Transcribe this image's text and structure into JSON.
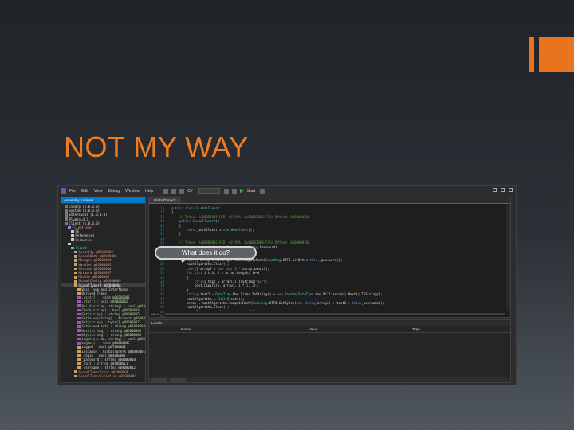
{
  "slide": {
    "title": "NOT MY WAY",
    "accent_color": "#e8741e",
    "title_color": "#f07c22"
  },
  "ide": {
    "menu": [
      "File",
      "Edit",
      "View",
      "Debug",
      "Window",
      "Help"
    ],
    "toolbar": {
      "config_select": "C#",
      "start_label": "Start"
    },
    "explorer": {
      "title": "Assembly Explorer",
      "items": [
        {
          "label": "CSharp (1.0.0.0)",
          "color": "#dcdcdc"
        },
        {
          "label": "System (4.0.0.0)",
          "color": "#dcdcdc"
        },
        {
          "label": "Extensions (1.0.0.0)",
          "color": "#dcdcdc"
        },
        {
          "label": "Plugin.dll",
          "color": "#dcdcdc"
        },
        {
          "label": "Client (1.0.0.0)",
          "color": "#dcdcdc"
        },
        {
          "label": "Client.exe",
          "color": "#d69d85"
        },
        {
          "label": "PE",
          "color": "#dcdcdc"
        },
        {
          "label": "References",
          "color": "#dcdcdc"
        },
        {
          "label": "Resources",
          "color": "#dcdcdc"
        },
        {
          "label": "{ }",
          "color": "#dcdcdc"
        },
        {
          "label": "Client",
          "color": "#4ec9b0"
        },
        {
          "label": "Security @02000002",
          "color": "#d69d85"
        },
        {
          "label": "GlobalData @02000003",
          "color": "#d69d85"
        },
        {
          "label": "Manager @02000004",
          "color": "#d69d85"
        },
        {
          "label": "Handler @02000005",
          "color": "#d69d85"
        },
        {
          "label": "Session @02000006",
          "color": "#d69d85"
        },
        {
          "label": "Network @02000007",
          "color": "#d69d85"
        },
        {
          "label": "Module @02000008",
          "color": "#d69d85"
        },
        {
          "label": "GlobalConfig @02000009",
          "color": "#d69d85"
        },
        {
          "label": "GlobalTunerX @0200000A",
          "color": "#ffffff"
        },
        {
          "label": "Base Type and Interfaces",
          "color": "#dcdcdc"
        },
        {
          "label": "Derived Types",
          "color": "#dcdcdc"
        },
        {
          "label": ".cctor() : void @06000001",
          "color": "#b8d7a3"
        },
        {
          "label": ".ctor() : void @06000002",
          "color": "#b8d7a3"
        },
        {
          "label": "Build(string, string) : bool @06000003",
          "color": "#b8d7a3"
        },
        {
          "label": "Check(string) : bool @06000004",
          "color": "#b8d7a3"
        },
        {
          "label": "Get(string) : string @06000005",
          "color": "#b8d7a3"
        },
        {
          "label": "GetValue(string) : Account @06000006",
          "color": "#b8d7a3"
        },
        {
          "label": "Set(string) : byte[] @06000007",
          "color": "#b8d7a3"
        },
        {
          "label": "SetSecond(int) : string @06000008",
          "color": "#b8d7a3"
        },
        {
          "label": "Hash(string) : string @06000009",
          "color": "#b8d7a3"
        },
        {
          "label": "Keys(string) : string @0600000A",
          "color": "#b8d7a3"
        },
        {
          "label": "Login(string, string) : bool @0600000B",
          "color": "#b8d7a3"
        },
        {
          "label": "Logout() : void @0600000C",
          "color": "#b8d7a3"
        },
        {
          "label": "Logged : bool @17000001",
          "color": "#dcdcdc"
        },
        {
          "label": "Instance : GlobalTunerX @0400000E",
          "color": "#dcdcdc"
        },
        {
          "label": "_login : bool @0400000F",
          "color": "#dcdcdc"
        },
        {
          "label": "_password : string @04000010",
          "color": "#dcdcdc"
        },
        {
          "label": "_salt : string @04000011",
          "color": "#dcdcdc"
        },
        {
          "label": "_username : string @04000012",
          "color": "#dcdcdc"
        },
        {
          "label": "GlobalTunerError @0200000B",
          "color": "#d69d85"
        },
        {
          "label": "GlobalTunerException @0200000C",
          "color": "#d69d85"
        }
      ]
    },
    "editor": {
      "tab": "GlobalTunerX",
      "zoom": "100 %",
      "line_numbers": [
        "16",
        "17",
        "18",
        "19",
        "20",
        "21",
        "22",
        "23",
        "24",
        "25",
        "26",
        "27",
        "28",
        "29",
        "30",
        "31",
        "32",
        "33",
        "34",
        "35",
        "36",
        "37",
        "38",
        "39",
        "40",
        "41",
        "42",
        "43"
      ]
    },
    "locals": {
      "title": "Locals",
      "columns": [
        "Name",
        "Value",
        "Type"
      ]
    }
  },
  "callout": {
    "text": "What does it do?"
  }
}
